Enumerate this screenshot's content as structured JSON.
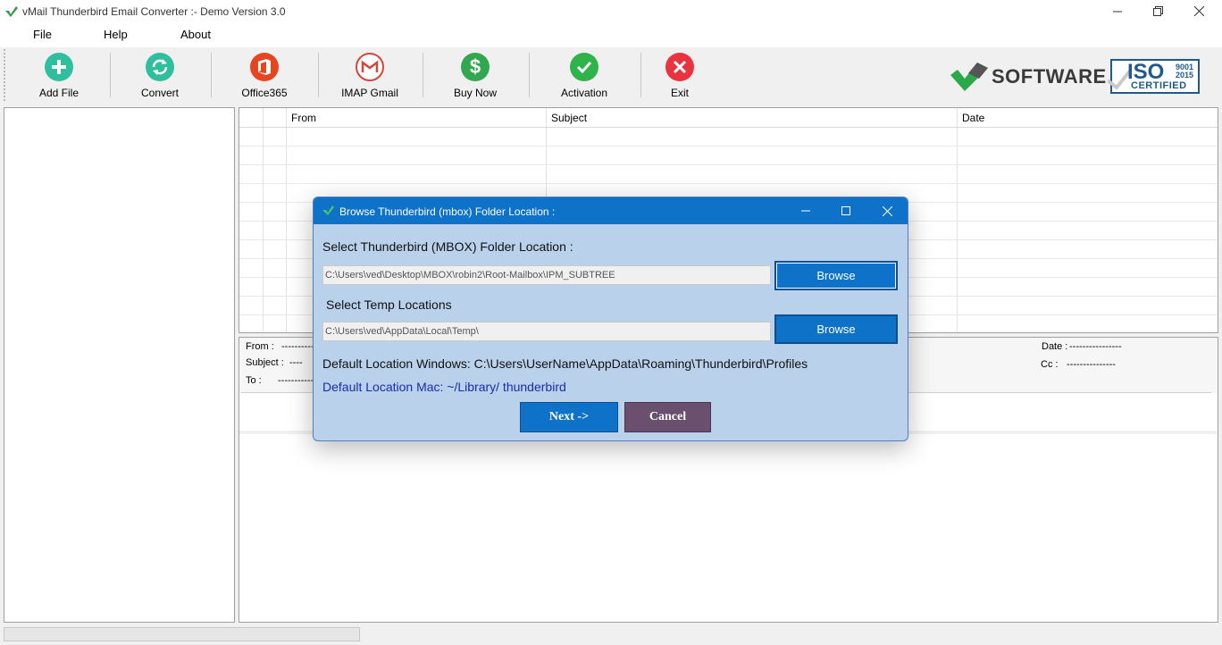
{
  "window": {
    "title": "vMail Thunderbird Email Converter  :- Demo Version 3.0"
  },
  "menu": {
    "file": "File",
    "help": "Help",
    "about": "About"
  },
  "toolbar": {
    "add_file": "Add File",
    "convert": "Convert",
    "office365": "Office365",
    "imap_gmail": "IMAP Gmail",
    "buy_now": "Buy Now",
    "activation": "Activation",
    "exit": "Exit"
  },
  "branding": {
    "software": "SOFTWARE",
    "iso": "ISO",
    "iso_num1": "9001",
    "iso_num2": "2015",
    "iso_certified": "CERTIFIED"
  },
  "grid": {
    "col_from": "From",
    "col_subject": "Subject",
    "col_date": "Date"
  },
  "preview": {
    "from_label": "From :",
    "from_value": "--------------",
    "subject_label": "Subject :",
    "subject_value": "----",
    "to_label": "To :",
    "to_value": "--------------",
    "date_label": "Date :",
    "date_value": "----------------",
    "cc_label": "Cc :",
    "cc_value": "---------------"
  },
  "dialog": {
    "title": "Browse Thunderbird (mbox) Folder Location :",
    "mbox_label": "Select Thunderbird (MBOX) Folder Location :",
    "mbox_path": "C:\\Users\\ved\\Desktop\\MBOX\\robin2\\Root-Mailbox\\IPM_SUBTREE",
    "browse1": "Browse",
    "temp_label": "Select Temp Locations",
    "temp_path": "C:\\Users\\ved\\AppData\\Local\\Temp\\",
    "browse2": "Browse",
    "default_windows": "Default Location Windows: C:\\Users\\UserName\\AppData\\Roaming\\Thunderbird\\Profiles",
    "default_mac": "Default Location Mac: ~/Library/ thunderbird",
    "next": "Next  ->",
    "cancel": "Cancel"
  },
  "colors": {
    "dialog_bg": "#b9d1ea",
    "dialog_title": "#0e72c8",
    "cancel_bg": "#6a4f6f",
    "accent_green": "#2fbf71"
  },
  "icons": {
    "add_file": "plus-circle-icon",
    "convert": "refresh-icon",
    "office365": "office-icon",
    "imap_gmail": "gmail-icon",
    "buy_now": "dollar-icon",
    "activation": "check-icon",
    "exit": "close-circle-icon"
  }
}
